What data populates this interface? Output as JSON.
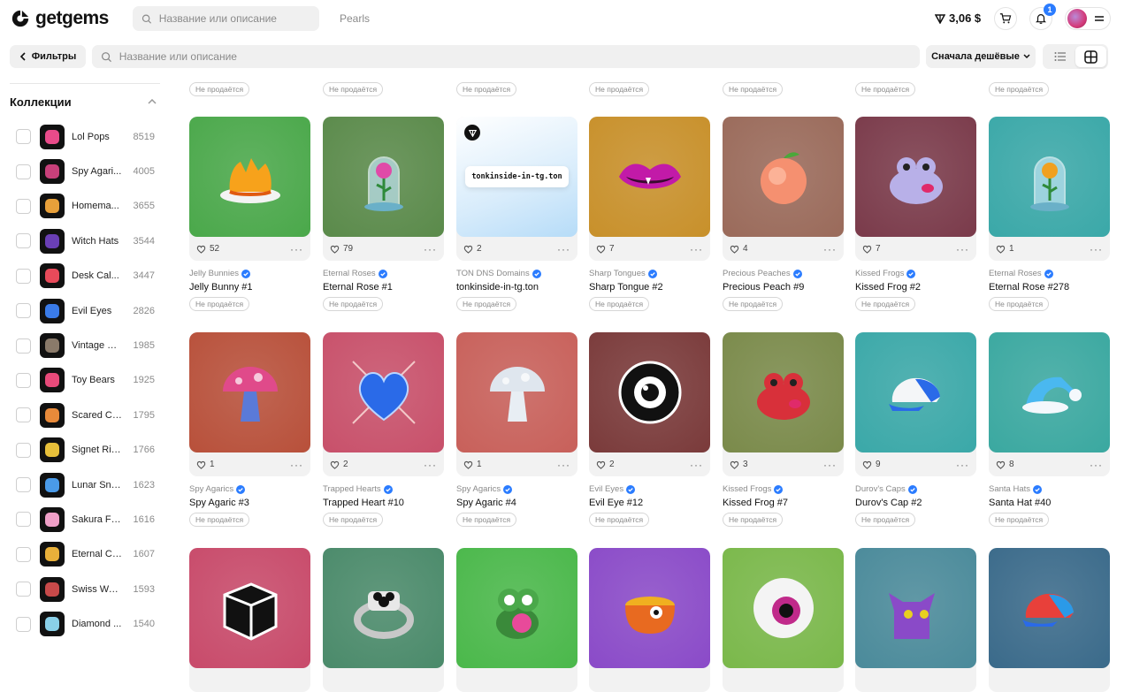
{
  "brand": {
    "name": "getgems"
  },
  "header": {
    "search_placeholder": "Название или описание",
    "breadcrumb": "Pearls",
    "balance": "3,06 $",
    "notifications_count": "1"
  },
  "toolbar": {
    "filters_label": "Фильтры",
    "search_placeholder": "Название или описание",
    "sort_label": "Сначала дешёвые"
  },
  "sidebar": {
    "title": "Коллекции",
    "items": [
      {
        "name": "Lol Pops",
        "count": "8519",
        "color": "#e94b8a"
      },
      {
        "name": "Spy Agari...",
        "count": "4005",
        "color": "#c8407a"
      },
      {
        "name": "Homema...",
        "count": "3655",
        "color": "#e8a03a"
      },
      {
        "name": "Witch Hats",
        "count": "3544",
        "color": "#6a3fb5"
      },
      {
        "name": "Desk Cal...",
        "count": "3447",
        "color": "#e84a5a"
      },
      {
        "name": "Evil Eyes",
        "count": "2826",
        "color": "#3a7be8"
      },
      {
        "name": "Vintage Ci...",
        "count": "1985",
        "color": "#8a7a6a"
      },
      {
        "name": "Toy Bears",
        "count": "1925",
        "color": "#e84a7a"
      },
      {
        "name": "Scared Cats",
        "count": "1795",
        "color": "#e88a3a"
      },
      {
        "name": "Signet Rin...",
        "count": "1766",
        "color": "#e8c03a"
      },
      {
        "name": "Lunar Sna...",
        "count": "1623",
        "color": "#4a9ae8"
      },
      {
        "name": "Sakura Flo...",
        "count": "1616",
        "color": "#f0a0c8"
      },
      {
        "name": "Eternal Ca...",
        "count": "1607",
        "color": "#e8b03a"
      },
      {
        "name": "Swiss Wat...",
        "count": "1593",
        "color": "#c84a4a"
      },
      {
        "name": "Diamond ...",
        "count": "1540",
        "color": "#8ad0e8"
      }
    ]
  },
  "status_label": "Не продаётся",
  "rows": [
    [
      {
        "collection": "Jelly Bunnies",
        "name": "Jelly Bunny #1",
        "likes": "52",
        "bg": "#4aa84a",
        "icon": "jelly-icon"
      },
      {
        "collection": "Eternal Roses",
        "name": "Eternal Rose #1",
        "likes": "79",
        "bg": "#5a8a4a",
        "icon": "rose-icon"
      },
      {
        "collection": "TON DNS Domains",
        "name": "tonkinside-in-tg.ton",
        "likes": "2",
        "bg": "#d8ecfb",
        "icon": "dns-icon",
        "domain_text": "tonkinside-in-tg.ton"
      },
      {
        "collection": "Sharp Tongues",
        "name": "Sharp Tongue #2",
        "likes": "7",
        "bg": "#c8902a",
        "icon": "lips-icon"
      },
      {
        "collection": "Precious Peaches",
        "name": "Precious Peach #9",
        "likes": "4",
        "bg": "#9a6a5a",
        "icon": "peach-icon"
      },
      {
        "collection": "Kissed Frogs",
        "name": "Kissed Frog #2",
        "likes": "7",
        "bg": "#7a3a4a",
        "icon": "frog-icon"
      },
      {
        "collection": "Eternal Roses",
        "name": "Eternal Rose #278",
        "likes": "1",
        "bg": "#3aa8a8",
        "icon": "rose-icon"
      }
    ],
    [
      {
        "collection": "Spy Agarics",
        "name": "Spy Agaric #3",
        "likes": "1",
        "bg": "#b8503a",
        "icon": "mushroom-icon"
      },
      {
        "collection": "Trapped Hearts",
        "name": "Trapped Heart #10",
        "likes": "2",
        "bg": "#c8506a",
        "icon": "heart-icon"
      },
      {
        "collection": "Spy Agarics",
        "name": "Spy Agaric #4",
        "likes": "1",
        "bg": "#c8605a",
        "icon": "mushroom-icon"
      },
      {
        "collection": "Evil Eyes",
        "name": "Evil Eye #12",
        "likes": "2",
        "bg": "#7a3a3a",
        "icon": "evil-eye-icon"
      },
      {
        "collection": "Kissed Frogs",
        "name": "Kissed Frog #7",
        "likes": "3",
        "bg": "#7a8a4a",
        "icon": "frog-icon"
      },
      {
        "collection": "Durov's Caps",
        "name": "Durov's Cap #2",
        "likes": "9",
        "bg": "#3aa8a8",
        "icon": "cap-icon"
      },
      {
        "collection": "Santa Hats",
        "name": "Santa Hat #40",
        "likes": "8",
        "bg": "#3aa8a0",
        "icon": "santa-hat-icon"
      }
    ],
    [
      {
        "bg": "#c84a6a",
        "icon": "box-icon"
      },
      {
        "bg": "#4a8a6a",
        "icon": "ring-icon"
      },
      {
        "bg": "#4ab84a",
        "icon": "pepe-icon"
      },
      {
        "bg": "#8a4ac8",
        "icon": "cauldron-icon"
      },
      {
        "bg": "#7ab84a",
        "icon": "eyeball-icon"
      },
      {
        "bg": "#4a8a9a",
        "icon": "cat-icon"
      },
      {
        "bg": "#3a6a8a",
        "icon": "cap-icon"
      }
    ]
  ]
}
